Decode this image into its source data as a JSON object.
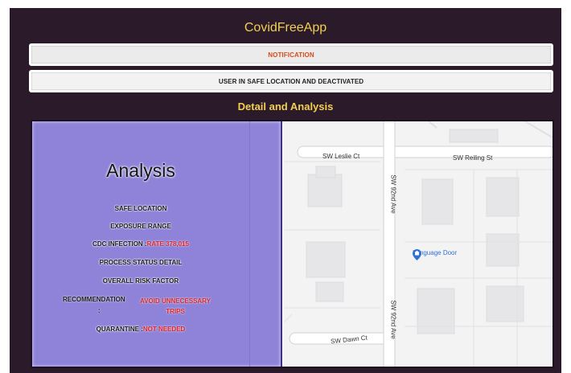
{
  "app": {
    "title": "CovidFreeApp"
  },
  "notification": {
    "label": "NOTIFICATION"
  },
  "status": {
    "label": "USER IN SAFE LOCATION AND DEACTIVATED"
  },
  "section": {
    "title": "Detail and Analysis"
  },
  "analysis": {
    "title": "Analysis",
    "safe_location": "SAFE LOCATION",
    "exposure_range": "EXPOSURE RANGE",
    "cdc_label": "CDC INFECTION :",
    "cdc_value": "RATE 378,015",
    "process_status": "PROCESS STATUS DETAIL",
    "overall_risk": "OVERALL RISK FACTOR",
    "recommendation_label": "RECOMMENDATION",
    "recommendation_colon": ":",
    "recommendation_value": "AVOID UNNECESSARY TRIPS",
    "quarantine_label": "QUARANTINE :",
    "quarantine_value": "NOT NEEDED"
  },
  "map": {
    "streets": {
      "leslie": "SW Leslie Ct",
      "reiling": "SW Reiling St",
      "ave_top": "SW 92nd Ave",
      "ave_bottom": "SW 92nd Ave",
      "dawn": "SW Dawn Ct"
    },
    "poi": {
      "name": "Language Door",
      "icon": "map-pin-icon",
      "color": "#2f6fd6"
    }
  },
  "colors": {
    "background": "#2b1a29",
    "accent": "#f2cf52",
    "notification": "#d84a16",
    "analysis_panel": "#8e83d8",
    "alert": "#e02424"
  }
}
